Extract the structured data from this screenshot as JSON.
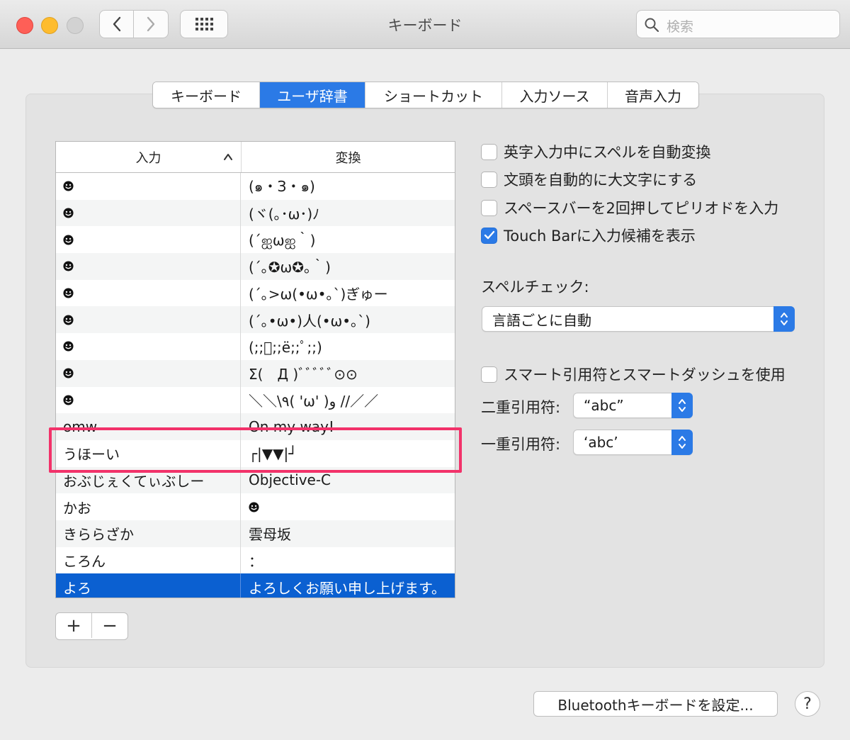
{
  "window": {
    "title": "キーボード",
    "search_placeholder": "検索"
  },
  "tabs": [
    {
      "label": "キーボード",
      "active": false
    },
    {
      "label": "ユーザ辞書",
      "active": true
    },
    {
      "label": "ショートカット",
      "active": false
    },
    {
      "label": "入力ソース",
      "active": false
    },
    {
      "label": "音声入力",
      "active": false
    }
  ],
  "table": {
    "headers": {
      "input": "入力",
      "convert": "変換"
    },
    "rows": [
      {
        "input_icon": "smiley-icon",
        "output": "(๑・З・๑)"
      },
      {
        "input_icon": "smiley-icon",
        "output": "(ヾ(｡･ω･)ﾉ"
      },
      {
        "input_icon": "smiley-icon",
        "output": "(´ஐωஐ｀)"
      },
      {
        "input_icon": "smiley-icon",
        "output": "(´｡✪ω✪｡｀)"
      },
      {
        "input_icon": "smiley-icon",
        "output": "(´｡>ω(•ω•｡`)ぎゅー"
      },
      {
        "input_icon": "smiley-icon",
        "output": "(´｡•ω•)人(•ω•｡`)"
      },
      {
        "input_icon": "smiley-icon",
        "output": "(;;ﾟ;;ё;;ﾟ;;)"
      },
      {
        "input_icon": "smiley-icon",
        "output": "Σ(　Д )ﾞﾞﾞﾞﾞ⊙⊙"
      },
      {
        "input_icon": "smiley-icon",
        "output": "＼＼\\٩( 'ω' )و //／／"
      },
      {
        "input": "omw",
        "output": "On my way!"
      },
      {
        "input": "うほーい",
        "output": "┌|▼▼|┘"
      },
      {
        "input": "おぶじぇくてぃぶしー",
        "output": "Objective-C"
      },
      {
        "input": "かお",
        "output_icon": "smiley-icon"
      },
      {
        "input": "きららざか",
        "output": "雲母坂"
      },
      {
        "input": "ころん",
        "output": "："
      },
      {
        "input": "よろ",
        "output": "よろしくお願い申し上げます。",
        "selected": true
      }
    ]
  },
  "buttons": {
    "add": "+",
    "remove": "−"
  },
  "options": {
    "auto_spell": "英字入力中にスペルを自動変換",
    "auto_capitalize": "文頭を自動的に大文字にする",
    "double_space_period": "スペースバーを2回押してピリオドを入力",
    "touchbar_candidates": "Touch Barに入力候補を表示",
    "smart_quotes": "スマート引用符とスマートダッシュを使用"
  },
  "option_states": {
    "auto_spell": false,
    "auto_capitalize": false,
    "double_space_period": false,
    "touchbar_candidates": true,
    "smart_quotes": false
  },
  "spellcheck": {
    "label": "スペルチェック:",
    "value": "言語ごとに自動"
  },
  "quotes": {
    "double_label": "二重引用符:",
    "double_value": "“abc”",
    "single_label": "一重引用符:",
    "single_value": "‘abc’"
  },
  "footer": {
    "bluetooth_button": "Bluetoothキーボードを設定...",
    "help": "?"
  },
  "colors": {
    "accent": "#2b7ae6",
    "selection": "#0b60d1",
    "highlight_box": "#f2326a"
  }
}
